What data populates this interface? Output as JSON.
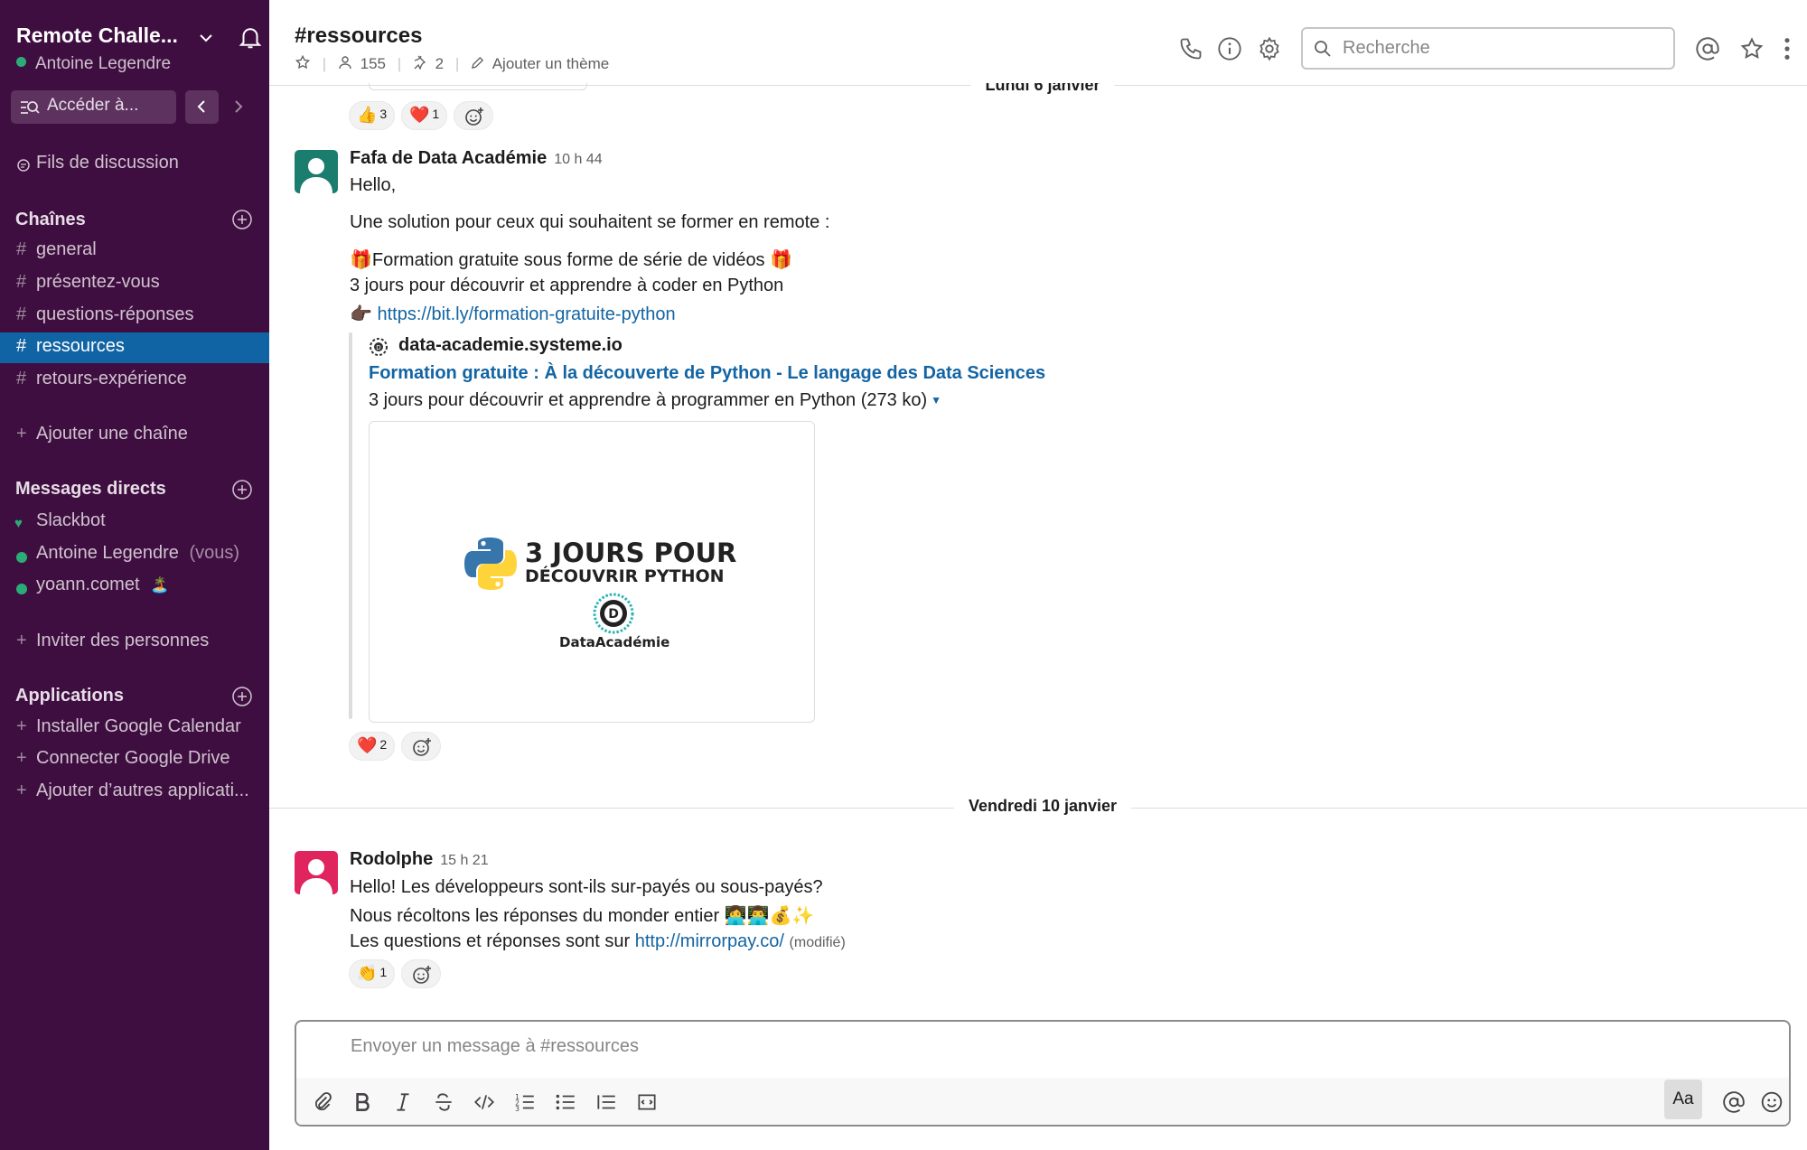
{
  "workspace": {
    "name": "Remote Challe...",
    "user": "Antoine Legendre",
    "jump_label": "Accéder à..."
  },
  "sidebar": {
    "threads_label": "Fils de discussion",
    "channels_title": "Chaînes",
    "channels": [
      {
        "name": "general"
      },
      {
        "name": "présentez-vous"
      },
      {
        "name": "questions-réponses"
      },
      {
        "name": "ressources"
      },
      {
        "name": "retours-expérience"
      }
    ],
    "add_channel": "Ajouter une chaîne",
    "dm_title": "Messages directs",
    "dms": [
      {
        "name": "Slackbot"
      },
      {
        "name": "Antoine Legendre",
        "suffix": "(vous)"
      },
      {
        "name": "yoann.comet",
        "status_emoji": "🏝️"
      }
    ],
    "invite": "Inviter des personnes",
    "apps_title": "Applications",
    "apps": [
      {
        "label": "Installer Google Calendar"
      },
      {
        "label": "Connecter Google Drive"
      },
      {
        "label": "Ajouter d’autres applicati..."
      }
    ]
  },
  "header": {
    "channel": "#ressources",
    "members": "155",
    "pins": "2",
    "topic_placeholder": "Ajouter un thème",
    "search_placeholder": "Recherche"
  },
  "top_reactions": [
    {
      "emoji": "👍",
      "count": "3"
    },
    {
      "emoji": "❤️",
      "count": "1"
    }
  ],
  "days": [
    "Lundi 6 janvier",
    "Vendredi 10 janvier"
  ],
  "message1": {
    "author": "Fafa de Data Académie",
    "time": "10 h 44",
    "line1": "Hello,",
    "line2": "Une solution pour ceux qui souhaitent se former en remote :",
    "line3": "🎁Formation gratuite sous forme de série de vidéos 🎁",
    "line4": "3 jours pour découvrir et apprendre à coder en Python",
    "pointer": "👉🏿",
    "link": "https://bit.ly/formation-gratuite-python",
    "attachment": {
      "site": "data-academie.systeme.io",
      "title": "Formation gratuite : À la découverte de Python - Le langage des Data Sciences",
      "desc": "3 jours pour découvrir et apprendre à programmer en Python (273 ko)",
      "preview_line1": "3 JOURS POUR",
      "preview_line2": "DÉCOUVRIR PYTHON",
      "preview_logo_letter": "D",
      "preview_brand": "DataAcadémie"
    },
    "reactions": [
      {
        "emoji": "❤️",
        "count": "2"
      }
    ]
  },
  "message2": {
    "author": "Rodolphe",
    "time": "15 h 21",
    "line1": "Hello! Les développeurs sont-ils sur-payés ou sous-payés?",
    "line2": "Nous récoltons les réponses du monder entier",
    "line2_emojis": "👩‍💻👨‍💻💰✨",
    "line3": "Les questions et réponses sont sur",
    "link": "http://mirrorpay.co/",
    "edited": "(modifié)",
    "reactions": [
      {
        "emoji": "👏",
        "count": "1"
      }
    ]
  },
  "composer": {
    "placeholder": "Envoyer un message à #ressources",
    "format_label": "Aa"
  },
  "colors": {
    "sidebar_bg": "#3f0e40",
    "active_channel": "#1164a3",
    "link": "#1264a3",
    "presence": "#2bac76"
  }
}
